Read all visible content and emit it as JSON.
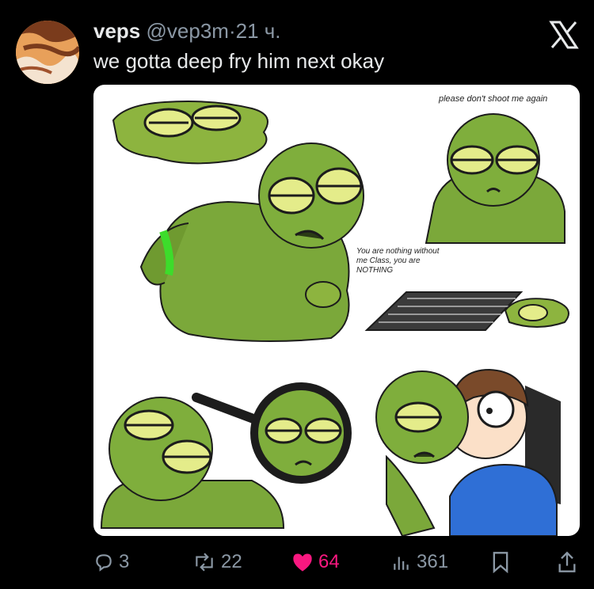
{
  "tweet": {
    "author_name": "veps",
    "author_handle": "@vep3m",
    "separator": "·",
    "time": "21 ч.",
    "text": "we gotta deep fry him next okay"
  },
  "media": {
    "caption_top": "please don't shoot me again",
    "caption_middle": "You are nothing without me Class, you are NOTHING"
  },
  "actions": {
    "replies": "3",
    "reposts": "22",
    "likes": "64",
    "views": "361"
  },
  "colors": {
    "background": "#000000",
    "text": "#e7e9ea",
    "muted": "#8b98a5",
    "like": "#f91880",
    "slime": "#7ba83a"
  },
  "icons": [
    "x-logo-icon",
    "reply-icon",
    "repost-icon",
    "heart-icon",
    "views-icon",
    "bookmark-icon",
    "share-icon"
  ]
}
